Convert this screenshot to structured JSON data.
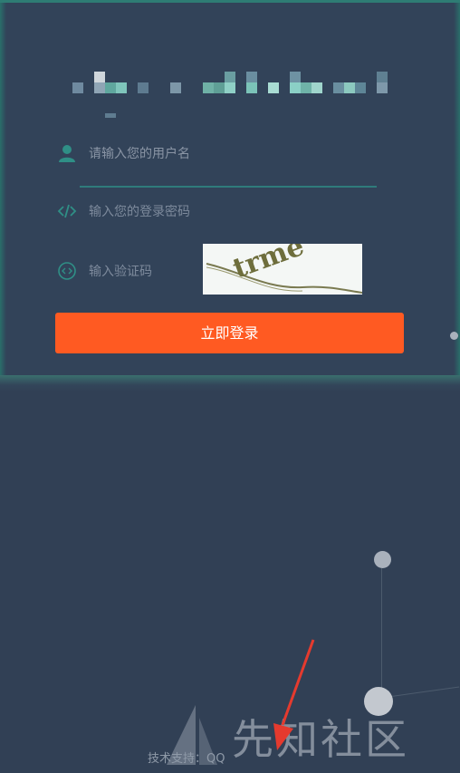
{
  "login_form": {
    "username_placeholder": "请输入您的用户名",
    "password_placeholder": "输入您的登录密码",
    "captcha_placeholder": "输入验证码",
    "captcha_text": "trme",
    "submit_label": "立即登录"
  },
  "footer": {
    "support_text": "技术支持：QQ"
  },
  "watermark": {
    "text": "先知社区"
  },
  "colors": {
    "background": "#314055",
    "accent_teal": "#2f7b7b",
    "button_orange": "#ff5a22"
  },
  "icons": {
    "username": "user-icon",
    "password": "code-icon",
    "captcha": "eye-icon"
  }
}
